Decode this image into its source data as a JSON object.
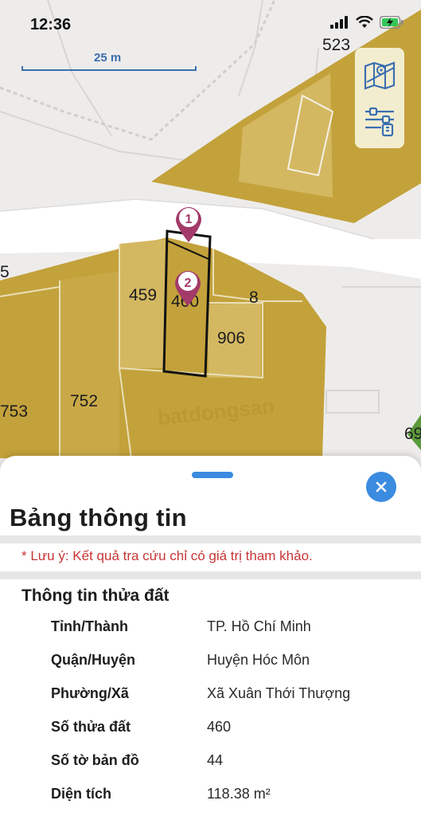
{
  "status": {
    "time": "12:36"
  },
  "map": {
    "scale_label": "25 m",
    "parcel_labels": [
      "523",
      "459",
      "460",
      "8",
      "906",
      "753",
      "752",
      "69",
      "5"
    ],
    "markers": [
      "1",
      "2"
    ],
    "watermark": "batdongsan",
    "colors": {
      "land": "#c3a23b",
      "land_light": "#d4b861",
      "road": "#ffffff",
      "background": "#eeeceb",
      "marker": "#a33a69"
    }
  },
  "tools": {
    "layers_icon": "map-layers-icon",
    "settings_icon": "sliders-icon"
  },
  "sheet": {
    "title": "Bảng thông tin",
    "note": "* Lưu ý: Kết quả tra cứu chỉ có giá trị tham khảo.",
    "section_title": "Thông tin thửa đất",
    "rows": [
      {
        "label": "Tỉnh/Thành",
        "value": "TP. Hồ Chí Minh"
      },
      {
        "label": "Quận/Huyện",
        "value": "Huyện Hóc Môn"
      },
      {
        "label": "Phường/Xã",
        "value": "Xã Xuân Thới Thượng"
      },
      {
        "label": "Số thửa đất",
        "value": "460"
      },
      {
        "label": "Số tờ bản đồ",
        "value": "44"
      },
      {
        "label": "Diện tích",
        "value": "118.38 m²"
      }
    ],
    "accent": "#3b8be0",
    "note_color": "#c73535"
  }
}
